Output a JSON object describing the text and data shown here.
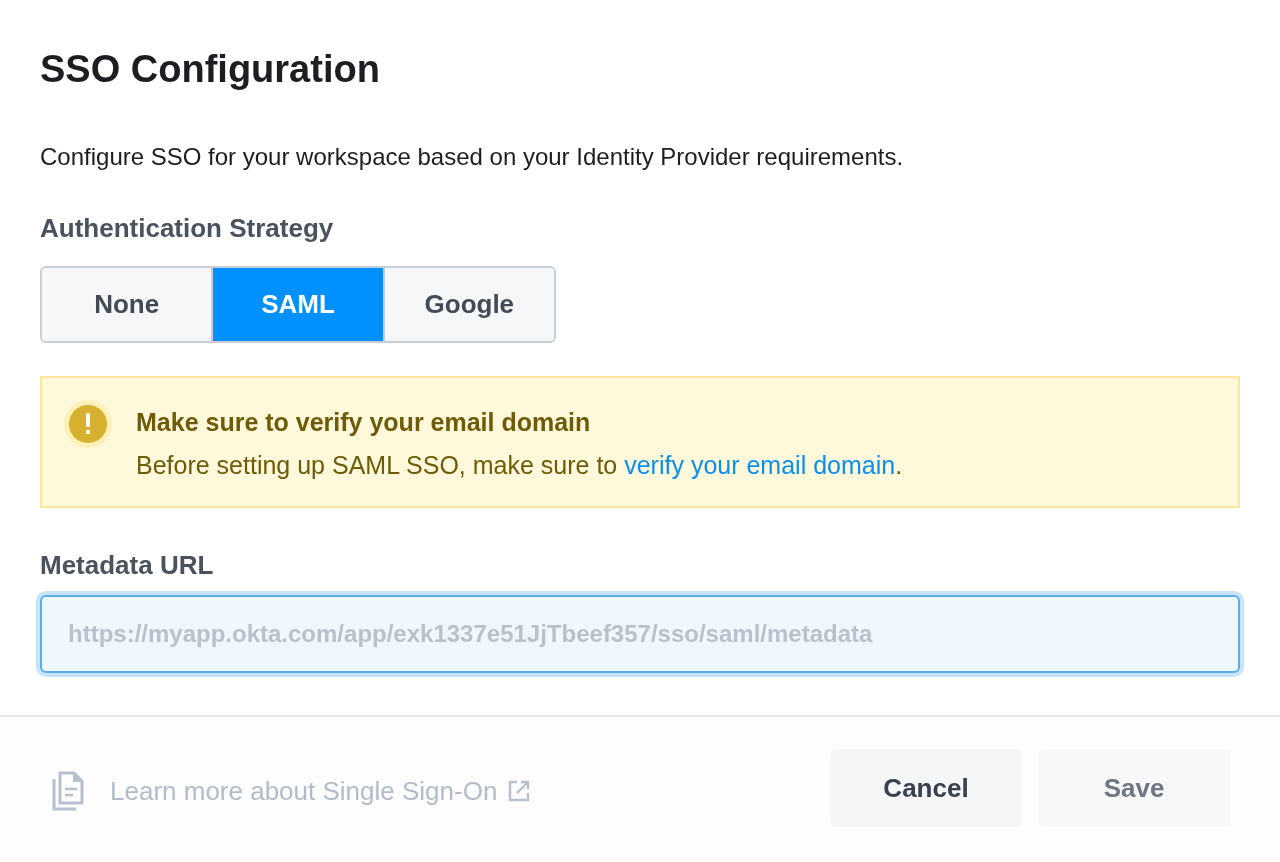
{
  "title": "SSO Configuration",
  "description": "Configure SSO for your workspace based on your Identity Provider requirements.",
  "strategy": {
    "label": "Authentication Strategy",
    "options": [
      {
        "label": "None",
        "selected": false
      },
      {
        "label": "SAML",
        "selected": true
      },
      {
        "label": "Google",
        "selected": false
      }
    ]
  },
  "alert": {
    "title": "Make sure to verify your email domain",
    "text_before": "Before setting up SAML SSO, make sure to ",
    "link": "verify your email domain",
    "text_after": "."
  },
  "metadata": {
    "label": "Metadata URL",
    "placeholder": "https://myapp.okta.com/app/exk1337e51JjTbeef357/sso/saml/metadata",
    "focused": true
  },
  "footer": {
    "link": "Learn more about Single Sign-On",
    "buttons": [
      {
        "label": "Cancel",
        "disabled": false
      },
      {
        "label": "Save",
        "disabled": true
      }
    ]
  }
}
